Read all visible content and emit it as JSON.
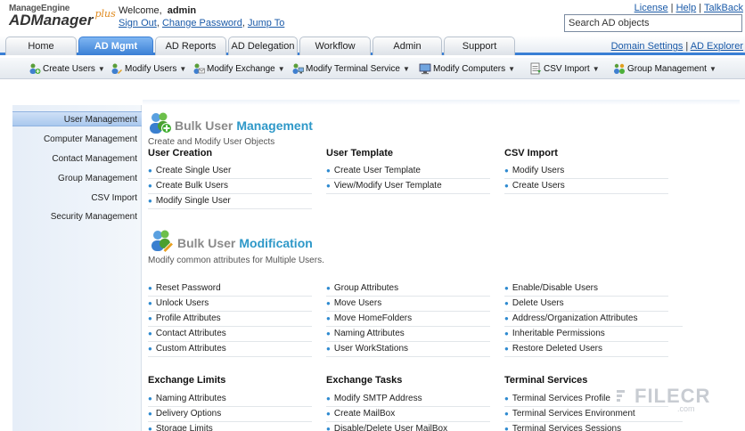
{
  "header": {
    "logo_top": "ManageEngine",
    "logo_main": "ADManager",
    "logo_plus": "plus",
    "welcome_label": "Welcome,",
    "username": "admin",
    "sign_out": "Sign Out",
    "change_password": "Change Password",
    "jump_to": "Jump To",
    "link_sep": ",",
    "pipe": "|",
    "license": "License",
    "help": "Help",
    "talkback": "TalkBack",
    "search_value": "Search AD objects"
  },
  "tabs": [
    {
      "label": "Home"
    },
    {
      "label": "AD Mgmt"
    },
    {
      "label": "AD Reports"
    },
    {
      "label": "AD Delegation"
    },
    {
      "label": "Workflow"
    },
    {
      "label": "Admin"
    },
    {
      "label": "Support"
    }
  ],
  "tab_links": {
    "domain_settings": "Domain Settings",
    "ad_explorer": "AD Explorer"
  },
  "toolbar": [
    {
      "label": "Create Users"
    },
    {
      "label": "Modify Users"
    },
    {
      "label": "Modify Exchange"
    },
    {
      "label": "Modify Terminal Service"
    },
    {
      "label": "Modify Computers"
    },
    {
      "label": "CSV Import"
    },
    {
      "label": "Group Management"
    }
  ],
  "sidebar": [
    {
      "label": "User Management"
    },
    {
      "label": "Computer Management"
    },
    {
      "label": "Contact Management"
    },
    {
      "label": "Group Management"
    },
    {
      "label": "CSV Import"
    },
    {
      "label": "Security Management"
    }
  ],
  "bulk_mgmt": {
    "title_a": "Bulk User",
    "title_b": "Management",
    "desc": "Create and Modify User Objects",
    "columns": [
      {
        "head": "User Creation",
        "items": [
          "Create Single User",
          "Create Bulk Users",
          "Modify Single User"
        ]
      },
      {
        "head": "User Template",
        "items": [
          "Create User Template",
          "View/Modify User Template"
        ]
      },
      {
        "head": "CSV Import",
        "items": [
          "Modify Users",
          "Create Users"
        ]
      }
    ]
  },
  "bulk_mod": {
    "title_a": "Bulk User",
    "title_b": "Modification",
    "desc": "Modify common attributes for Multiple Users.",
    "columns": [
      {
        "items": [
          "Reset Password",
          "Unlock Users",
          "Profile Attributes",
          "Contact Attributes",
          "Custom Attributes"
        ]
      },
      {
        "items": [
          "Group Attributes",
          "Move Users",
          "Move HomeFolders",
          "Naming Attributes",
          "User WorkStations"
        ]
      },
      {
        "items": [
          "Enable/Disable Users",
          "Delete Users",
          "Address/Organization Attributes",
          "Inheritable Permissions",
          "Restore Deleted Users"
        ]
      }
    ]
  },
  "lower": {
    "columns": [
      {
        "head": "Exchange Limits",
        "items": [
          "Naming Attributes",
          "Delivery Options",
          "Storage Limits"
        ]
      },
      {
        "head": "Exchange Tasks",
        "items": [
          "Modify SMTP Address",
          "Create MailBox",
          "Disable/Delete User MailBox"
        ]
      },
      {
        "head": "Terminal Services",
        "items": [
          "Terminal Services Profile",
          "Terminal Services Environment",
          "Terminal Services Sessions"
        ]
      }
    ]
  },
  "watermark": {
    "main": "FILECR",
    "sub": ".com"
  },
  "colors": {
    "accent": "#3a7fd5",
    "title_blue": "#2e98c8",
    "link": "#1a5aa8"
  }
}
